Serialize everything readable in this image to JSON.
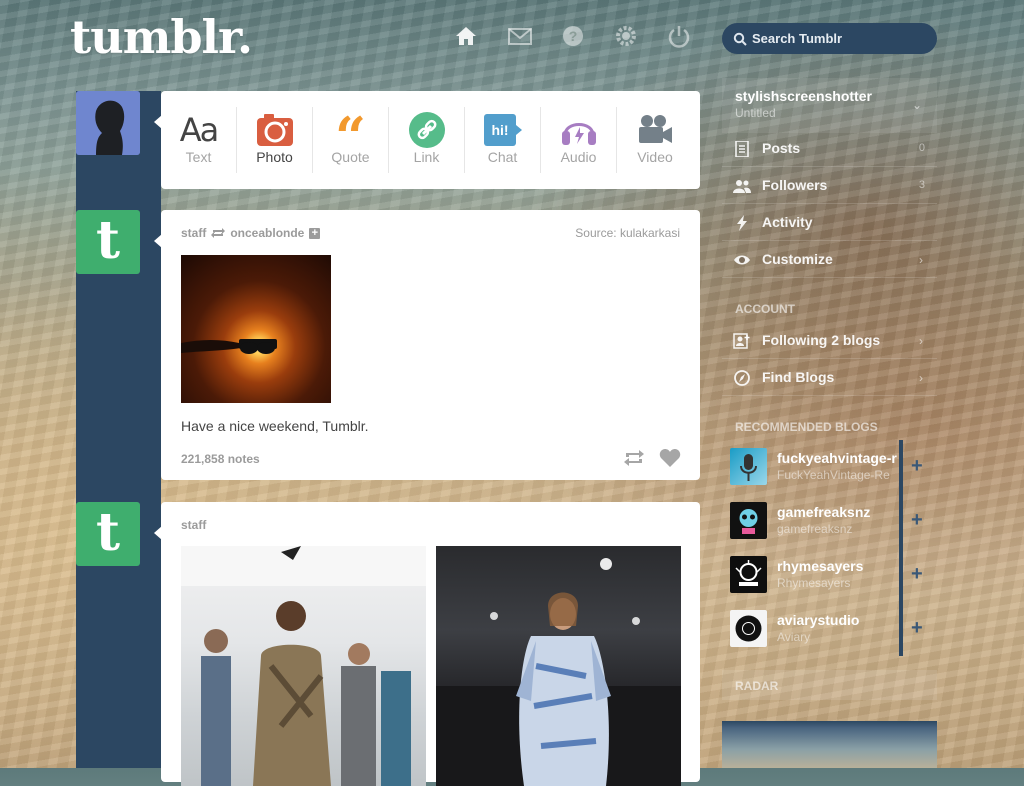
{
  "header": {
    "logo": "tumblr.",
    "nav_icons": [
      "home-icon",
      "mail-icon",
      "help-icon",
      "gear-icon",
      "power-icon"
    ],
    "search_placeholder": "Search Tumblr"
  },
  "post_types": [
    {
      "label": "Text",
      "icon": "text-icon",
      "color": "#444444"
    },
    {
      "label": "Photo",
      "icon": "camera-icon",
      "color": "#d95e40"
    },
    {
      "label": "Quote",
      "icon": "quote-icon",
      "color": "#f2992e"
    },
    {
      "label": "Link",
      "icon": "link-icon",
      "color": "#56bc8a"
    },
    {
      "label": "Chat",
      "icon": "chat-icon",
      "color": "#529ecc"
    },
    {
      "label": "Audio",
      "icon": "headphones-icon",
      "color": "#a77dc2"
    },
    {
      "label": "Video",
      "icon": "video-camera-icon",
      "color": "#748089"
    }
  ],
  "posts": [
    {
      "author": "staff",
      "reblogged_from": "onceablonde",
      "source_label": "Source:",
      "source": "kulakarkasi",
      "caption": "Have a nice weekend, Tumblr.",
      "notes": "221,858 notes"
    },
    {
      "author": "staff"
    }
  ],
  "sidebar": {
    "blog_name": "stylishscreenshotter",
    "blog_subtitle": "Untitled",
    "items": [
      {
        "label": "Posts",
        "icon": "document-icon",
        "count": "0"
      },
      {
        "label": "Followers",
        "icon": "people-icon",
        "count": "3"
      },
      {
        "label": "Activity",
        "icon": "lightning-icon",
        "count": ""
      },
      {
        "label": "Customize",
        "icon": "eye-icon",
        "count": ""
      }
    ],
    "account_heading": "ACCOUNT",
    "account_items": [
      {
        "label": "Following 2 blogs",
        "icon": "add-user-icon"
      },
      {
        "label": "Find Blogs",
        "icon": "compass-icon"
      }
    ],
    "recommended_heading": "RECOMMENDED BLOGS",
    "recommended": [
      {
        "name": "fuckyeahvintage-r",
        "subtitle": "FuckYeahVintage-Re"
      },
      {
        "name": "gamefreaksnz",
        "subtitle": "gamefreaksnz"
      },
      {
        "name": "rhymesayers",
        "subtitle": "Rhymesayers"
      },
      {
        "name": "aviarystudio",
        "subtitle": "Aviary"
      }
    ],
    "radar_heading": "RADAR"
  },
  "colors": {
    "brand_navy": "#2c4762",
    "tumblr_green": "#3fae6e"
  }
}
